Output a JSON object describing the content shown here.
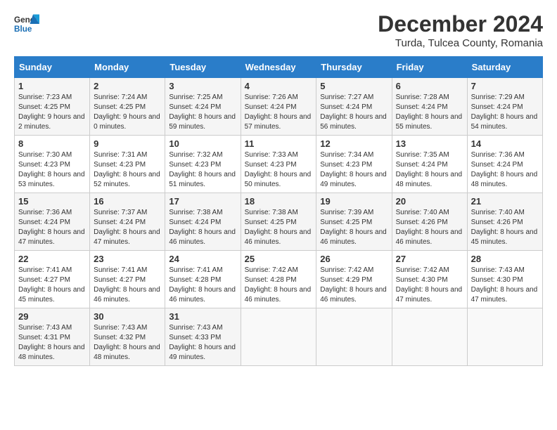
{
  "header": {
    "logo_line1": "General",
    "logo_line2": "Blue",
    "main_title": "December 2024",
    "subtitle": "Turda, Tulcea County, Romania"
  },
  "days_of_week": [
    "Sunday",
    "Monday",
    "Tuesday",
    "Wednesday",
    "Thursday",
    "Friday",
    "Saturday"
  ],
  "weeks": [
    [
      {
        "day": "1",
        "sunrise": "7:23 AM",
        "sunset": "4:25 PM",
        "daylight": "9 hours and 2 minutes."
      },
      {
        "day": "2",
        "sunrise": "7:24 AM",
        "sunset": "4:25 PM",
        "daylight": "9 hours and 0 minutes."
      },
      {
        "day": "3",
        "sunrise": "7:25 AM",
        "sunset": "4:24 PM",
        "daylight": "8 hours and 59 minutes."
      },
      {
        "day": "4",
        "sunrise": "7:26 AM",
        "sunset": "4:24 PM",
        "daylight": "8 hours and 57 minutes."
      },
      {
        "day": "5",
        "sunrise": "7:27 AM",
        "sunset": "4:24 PM",
        "daylight": "8 hours and 56 minutes."
      },
      {
        "day": "6",
        "sunrise": "7:28 AM",
        "sunset": "4:24 PM",
        "daylight": "8 hours and 55 minutes."
      },
      {
        "day": "7",
        "sunrise": "7:29 AM",
        "sunset": "4:24 PM",
        "daylight": "8 hours and 54 minutes."
      }
    ],
    [
      {
        "day": "8",
        "sunrise": "7:30 AM",
        "sunset": "4:23 PM",
        "daylight": "8 hours and 53 minutes."
      },
      {
        "day": "9",
        "sunrise": "7:31 AM",
        "sunset": "4:23 PM",
        "daylight": "8 hours and 52 minutes."
      },
      {
        "day": "10",
        "sunrise": "7:32 AM",
        "sunset": "4:23 PM",
        "daylight": "8 hours and 51 minutes."
      },
      {
        "day": "11",
        "sunrise": "7:33 AM",
        "sunset": "4:23 PM",
        "daylight": "8 hours and 50 minutes."
      },
      {
        "day": "12",
        "sunrise": "7:34 AM",
        "sunset": "4:23 PM",
        "daylight": "8 hours and 49 minutes."
      },
      {
        "day": "13",
        "sunrise": "7:35 AM",
        "sunset": "4:24 PM",
        "daylight": "8 hours and 48 minutes."
      },
      {
        "day": "14",
        "sunrise": "7:36 AM",
        "sunset": "4:24 PM",
        "daylight": "8 hours and 48 minutes."
      }
    ],
    [
      {
        "day": "15",
        "sunrise": "7:36 AM",
        "sunset": "4:24 PM",
        "daylight": "8 hours and 47 minutes."
      },
      {
        "day": "16",
        "sunrise": "7:37 AM",
        "sunset": "4:24 PM",
        "daylight": "8 hours and 47 minutes."
      },
      {
        "day": "17",
        "sunrise": "7:38 AM",
        "sunset": "4:24 PM",
        "daylight": "8 hours and 46 minutes."
      },
      {
        "day": "18",
        "sunrise": "7:38 AM",
        "sunset": "4:25 PM",
        "daylight": "8 hours and 46 minutes."
      },
      {
        "day": "19",
        "sunrise": "7:39 AM",
        "sunset": "4:25 PM",
        "daylight": "8 hours and 46 minutes."
      },
      {
        "day": "20",
        "sunrise": "7:40 AM",
        "sunset": "4:26 PM",
        "daylight": "8 hours and 46 minutes."
      },
      {
        "day": "21",
        "sunrise": "7:40 AM",
        "sunset": "4:26 PM",
        "daylight": "8 hours and 45 minutes."
      }
    ],
    [
      {
        "day": "22",
        "sunrise": "7:41 AM",
        "sunset": "4:27 PM",
        "daylight": "8 hours and 45 minutes."
      },
      {
        "day": "23",
        "sunrise": "7:41 AM",
        "sunset": "4:27 PM",
        "daylight": "8 hours and 46 minutes."
      },
      {
        "day": "24",
        "sunrise": "7:41 AM",
        "sunset": "4:28 PM",
        "daylight": "8 hours and 46 minutes."
      },
      {
        "day": "25",
        "sunrise": "7:42 AM",
        "sunset": "4:28 PM",
        "daylight": "8 hours and 46 minutes."
      },
      {
        "day": "26",
        "sunrise": "7:42 AM",
        "sunset": "4:29 PM",
        "daylight": "8 hours and 46 minutes."
      },
      {
        "day": "27",
        "sunrise": "7:42 AM",
        "sunset": "4:30 PM",
        "daylight": "8 hours and 47 minutes."
      },
      {
        "day": "28",
        "sunrise": "7:43 AM",
        "sunset": "4:30 PM",
        "daylight": "8 hours and 47 minutes."
      }
    ],
    [
      {
        "day": "29",
        "sunrise": "7:43 AM",
        "sunset": "4:31 PM",
        "daylight": "8 hours and 48 minutes."
      },
      {
        "day": "30",
        "sunrise": "7:43 AM",
        "sunset": "4:32 PM",
        "daylight": "8 hours and 48 minutes."
      },
      {
        "day": "31",
        "sunrise": "7:43 AM",
        "sunset": "4:33 PM",
        "daylight": "8 hours and 49 minutes."
      },
      null,
      null,
      null,
      null
    ]
  ],
  "labels": {
    "sunrise": "Sunrise:",
    "sunset": "Sunset:",
    "daylight": "Daylight:"
  }
}
